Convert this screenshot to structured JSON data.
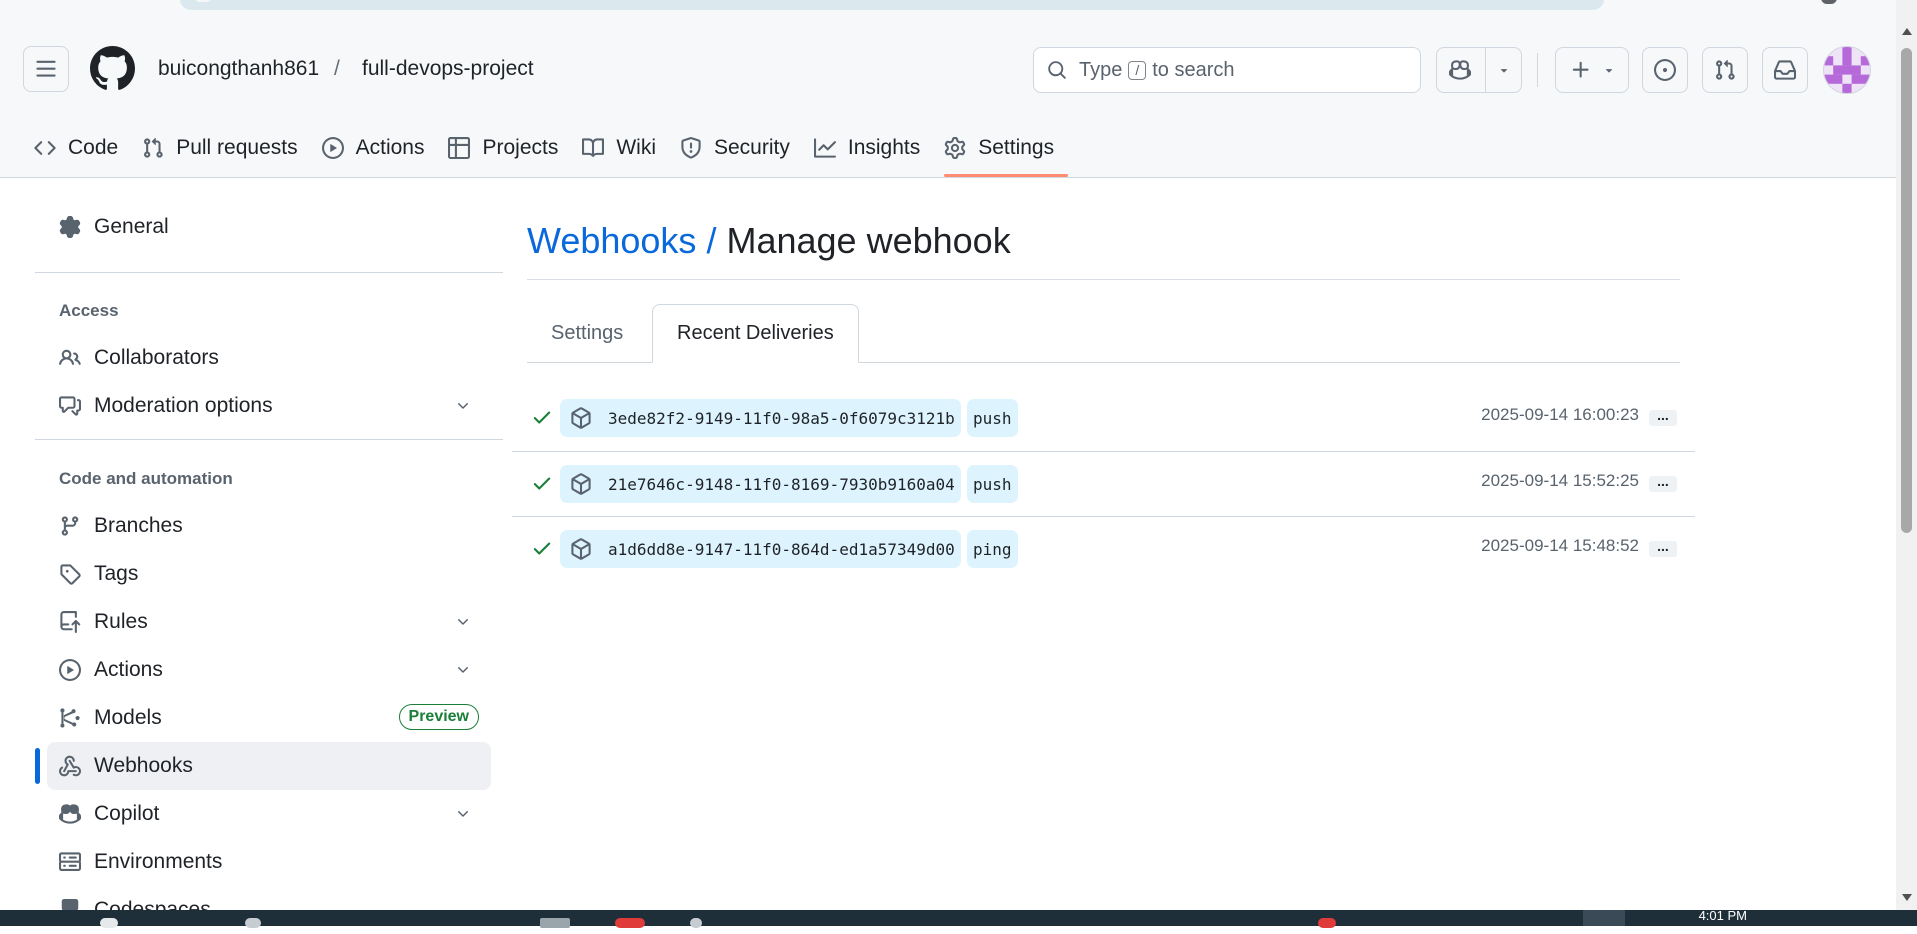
{
  "header": {
    "owner": "buicongthanh861",
    "separator": "/",
    "repo": "full-devops-project",
    "search_prefix": "Type",
    "search_key": "/",
    "search_suffix": "to search"
  },
  "repo_tabs": [
    {
      "label": "Code",
      "icon": "code-icon"
    },
    {
      "label": "Pull requests",
      "icon": "git-pull-request-icon"
    },
    {
      "label": "Actions",
      "icon": "play-icon"
    },
    {
      "label": "Projects",
      "icon": "table-icon"
    },
    {
      "label": "Wiki",
      "icon": "book-icon"
    },
    {
      "label": "Security",
      "icon": "shield-icon"
    },
    {
      "label": "Insights",
      "icon": "graph-icon"
    },
    {
      "label": "Settings",
      "icon": "gear-icon",
      "selected": true
    }
  ],
  "sidebar": {
    "general": "General",
    "access_heading": "Access",
    "collaborators": "Collaborators",
    "moderation": "Moderation options",
    "code_heading": "Code and automation",
    "branches": "Branches",
    "tags": "Tags",
    "rules": "Rules",
    "actions": "Actions",
    "models": "Models",
    "models_badge": "Preview",
    "webhooks": "Webhooks",
    "copilot": "Copilot",
    "environments": "Environments",
    "codespaces": "Codespaces"
  },
  "main": {
    "breadcrumb": "Webhooks",
    "breadcrumb_sep": "/",
    "title": "Manage webhook",
    "tabs": [
      {
        "label": "Settings",
        "selected": false
      },
      {
        "label": "Recent Deliveries",
        "selected": true
      }
    ],
    "deliveries": [
      {
        "guid": "3ede82f2-9149-11f0-98a5-0f6079c3121b",
        "event": "push",
        "timestamp": "2025-09-14 16:00:23",
        "more": "..."
      },
      {
        "guid": "21e7646c-9148-11f0-8169-7930b9160a04",
        "event": "push",
        "timestamp": "2025-09-14 15:52:25",
        "more": "..."
      },
      {
        "guid": "a1d6dd8e-9147-11f0-864d-ed1a57349d00",
        "event": "ping",
        "timestamp": "2025-09-14 15:48:52",
        "more": "..."
      }
    ]
  },
  "taskbar": {
    "clock": "4:01 PM"
  },
  "colors": {
    "accent_link": "#0969da",
    "success": "#1a7f37",
    "selected_tab_underline": "#fd8c73",
    "pill_bg": "#ddf4ff"
  }
}
